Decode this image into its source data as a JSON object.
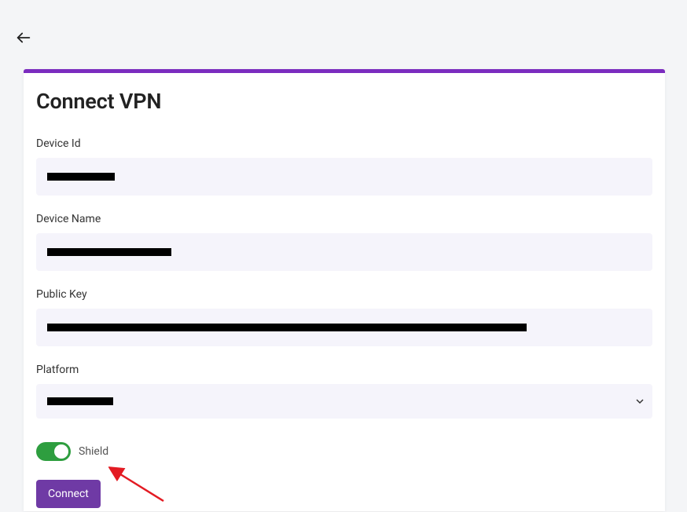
{
  "page_title": "Connect VPN",
  "fields": {
    "device_id": {
      "label": "Device Id",
      "value": "██████████"
    },
    "device_name": {
      "label": "Device Name",
      "value": "████████████████████"
    },
    "public_key": {
      "label": "Public Key",
      "value": "████████████████████████████████████████████████████████████████████████████"
    },
    "platform": {
      "label": "Platform",
      "value": "██████████"
    }
  },
  "toggle": {
    "label": "Shield",
    "on": true
  },
  "connect_label": "Connect"
}
